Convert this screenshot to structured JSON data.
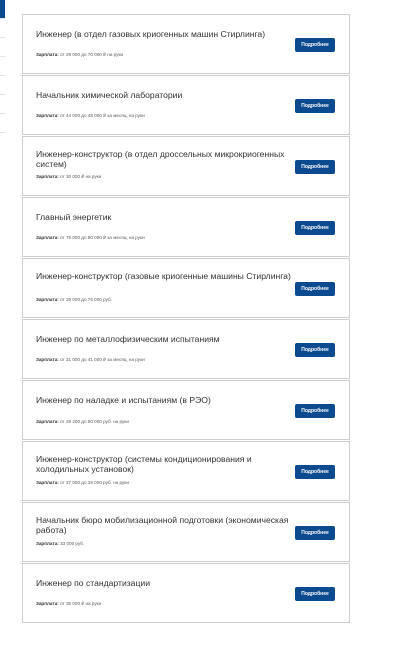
{
  "colors": {
    "accent": "#0b4a8f",
    "border": "#cfcfcf",
    "title_text": "#333333",
    "salary_text": "#5a5a5a"
  },
  "vacancies": [
    {
      "title": "Инженер (в отдел газовых криогенных машин Стирлинга)",
      "salary_label": "Зарплата:",
      "salary": "от 29 000 до 70 000 ₽ на руки",
      "button": "Подробнее"
    },
    {
      "title": "Начальник химической лаборатории",
      "salary_label": "Зарплата:",
      "salary": "от 44 000 до 48 000 ₽ за месяц, на руки",
      "button": "Подробнее"
    },
    {
      "title": "Инженер-конструктор (в отдел дроссельных микрокриогенных систем)",
      "salary_label": "Зарплата:",
      "salary": "от 30 000 ₽ на руки",
      "button": "Подробнее"
    },
    {
      "title": "Главный энергетик",
      "salary_label": "Зарплата:",
      "salary": "от 75 000 до 80 000 ₽ за месяц, на руки",
      "button": "Подробнее"
    },
    {
      "title": "Инженер-конструктор (газовые криогенные машины Стирлинга)",
      "salary_label": "Зарплата:",
      "salary": "от 29 000 до 75 000 руб.",
      "button": "Подробнее"
    },
    {
      "title": "Инженер по металлофизическим испытаниям",
      "salary_label": "Зарплата:",
      "salary": "от 31 000 до 41 000 ₽ за месяц, на руки",
      "button": "Подробнее"
    },
    {
      "title": "Инженер по наладке и испытаниям (в РЭО)",
      "salary_label": "Зарплата:",
      "salary": "от 29 200 до 60 000 руб. на руки",
      "button": "Подробнее"
    },
    {
      "title": "Инженер-конструктор (системы кондиционирования и холодильных установок)",
      "salary_label": "Зарплата:",
      "salary": "от 27 000 до 39 000 руб. на руки",
      "button": "Подробнее"
    },
    {
      "title": "Начальник бюро мобилизационной подготовки (экономическая работа)",
      "salary_label": "Зарплата:",
      "salary": "33 000 руб.",
      "button": "Подробнее"
    },
    {
      "title": "Инженер по стандартизации",
      "salary_label": "Зарплата:",
      "salary": "от 35 000 ₽ на руки",
      "button": "Подробнее"
    }
  ]
}
